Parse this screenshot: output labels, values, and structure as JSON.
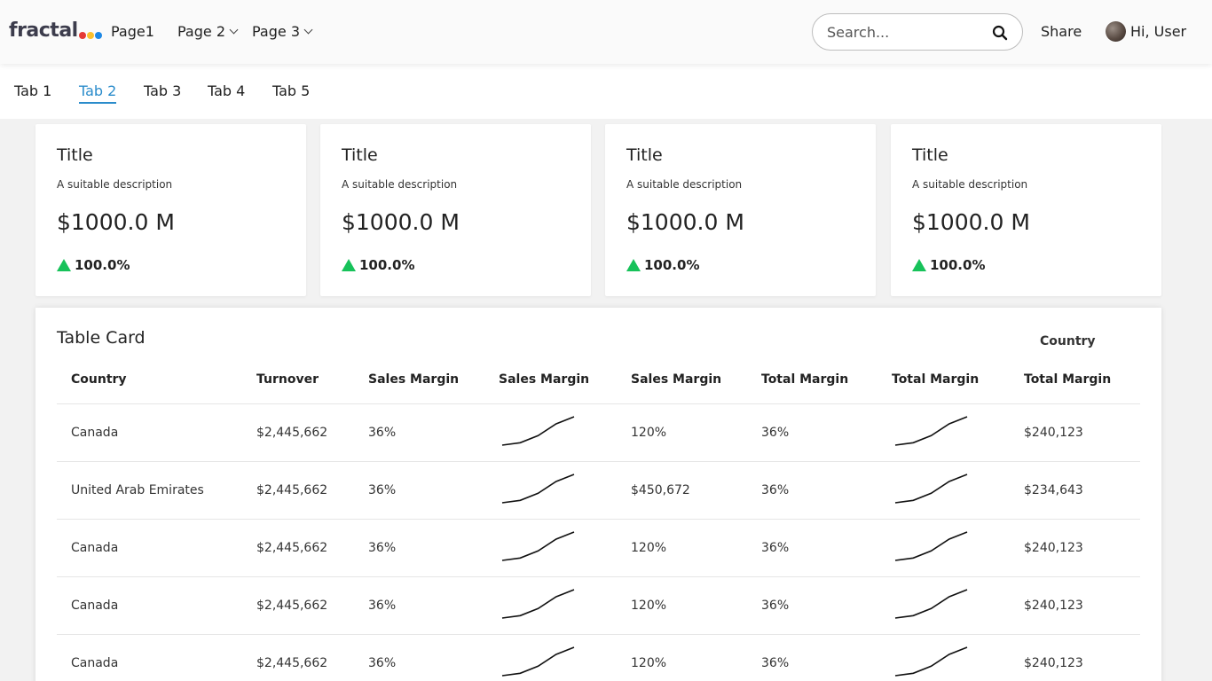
{
  "header": {
    "logo_text": "fractal",
    "logo_dot_colors": [
      "#e53935",
      "#fbc02d",
      "#1e88e5"
    ],
    "nav": [
      {
        "label": "Page1",
        "has_dropdown": false
      },
      {
        "label": "Page 2",
        "has_dropdown": true
      },
      {
        "label": "Page 3",
        "has_dropdown": true
      }
    ],
    "search_placeholder": "Search...",
    "share_label": "Share",
    "user_greeting": "Hi, User"
  },
  "tabs": [
    {
      "label": "Tab 1",
      "active": false
    },
    {
      "label": "Tab 2",
      "active": true
    },
    {
      "label": "Tab 3",
      "active": false
    },
    {
      "label": "Tab 4",
      "active": false
    },
    {
      "label": "Tab 5",
      "active": false
    }
  ],
  "accent_color": "#2b8ccb",
  "positive_color": "#17c25a",
  "kpi_cards": [
    {
      "title": "Title",
      "description": "A suitable description",
      "value": "$1000.0 M",
      "change": "100.0%",
      "trend": "up"
    },
    {
      "title": "Title",
      "description": "A suitable description",
      "value": "$1000.0 M",
      "change": "100.0%",
      "trend": "up"
    },
    {
      "title": "Title",
      "description": "A suitable description",
      "value": "$1000.0 M",
      "change": "100.0%",
      "trend": "up"
    },
    {
      "title": "Title",
      "description": "A suitable description",
      "value": "$1000.0 M",
      "change": "100.0%",
      "trend": "up"
    }
  ],
  "table_card": {
    "title": "Table Card",
    "filter_label": "Country",
    "columns": [
      "Country",
      "Turnover",
      "Sales Margin",
      "Sales Margin",
      "Sales Margin",
      "Total Margin",
      "Total Margin",
      "Total Margin"
    ],
    "sparkline_values": [
      0,
      1,
      4,
      9,
      12
    ],
    "rows": [
      {
        "country": "Canada",
        "turnover": "$2,445,662",
        "sales_margin": "36%",
        "sales_margin_2": "120%",
        "total_margin": "36%",
        "total_margin_2": "$240,123"
      },
      {
        "country": "United Arab Emirates",
        "turnover": "$2,445,662",
        "sales_margin": "36%",
        "sales_margin_2": "$450,672",
        "total_margin": "36%",
        "total_margin_2": "$234,643"
      },
      {
        "country": "Canada",
        "turnover": "$2,445,662",
        "sales_margin": "36%",
        "sales_margin_2": "120%",
        "total_margin": "36%",
        "total_margin_2": "$240,123"
      },
      {
        "country": "Canada",
        "turnover": "$2,445,662",
        "sales_margin": "36%",
        "sales_margin_2": "120%",
        "total_margin": "36%",
        "total_margin_2": "$240,123"
      },
      {
        "country": "Canada",
        "turnover": "$2,445,662",
        "sales_margin": "36%",
        "sales_margin_2": "120%",
        "total_margin": "36%",
        "total_margin_2": "$240,123"
      }
    ]
  }
}
